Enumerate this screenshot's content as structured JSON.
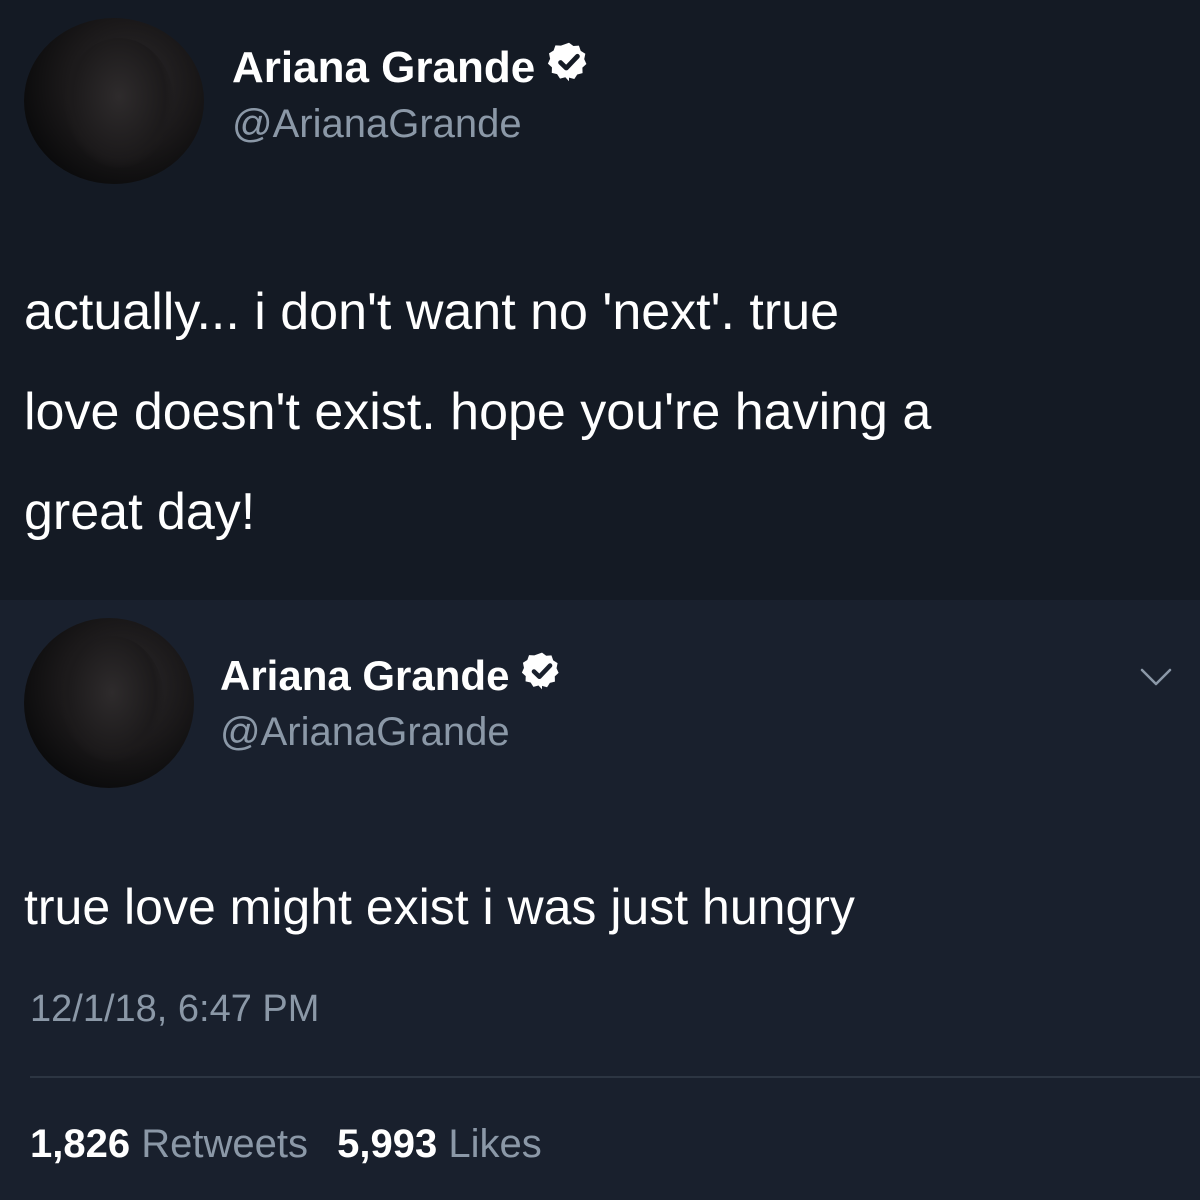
{
  "tweet1": {
    "name": "Ariana Grande",
    "handle": "@ArianaGrande",
    "lines": [
      "actually... i don't want no 'next'. true",
      "love doesn't exist. hope you're having a",
      "great day!"
    ],
    "avatar_icon": "avatar-photo"
  },
  "tweet2": {
    "name": "Ariana Grande",
    "handle": "@ArianaGrande",
    "text": "true love might exist i was just hungry",
    "timestamp": "12/1/18, 6:47 PM",
    "retweets_count": "1,826",
    "retweets_label": "Retweets",
    "likes_count": "5,993",
    "likes_label": "Likes",
    "menu_icon": "chevron-down-icon"
  },
  "colors": {
    "background_top": "#141a24",
    "background_bottom": "#19202d",
    "secondary_text": "#8b98a7",
    "verified_badge": "#ffffff"
  }
}
